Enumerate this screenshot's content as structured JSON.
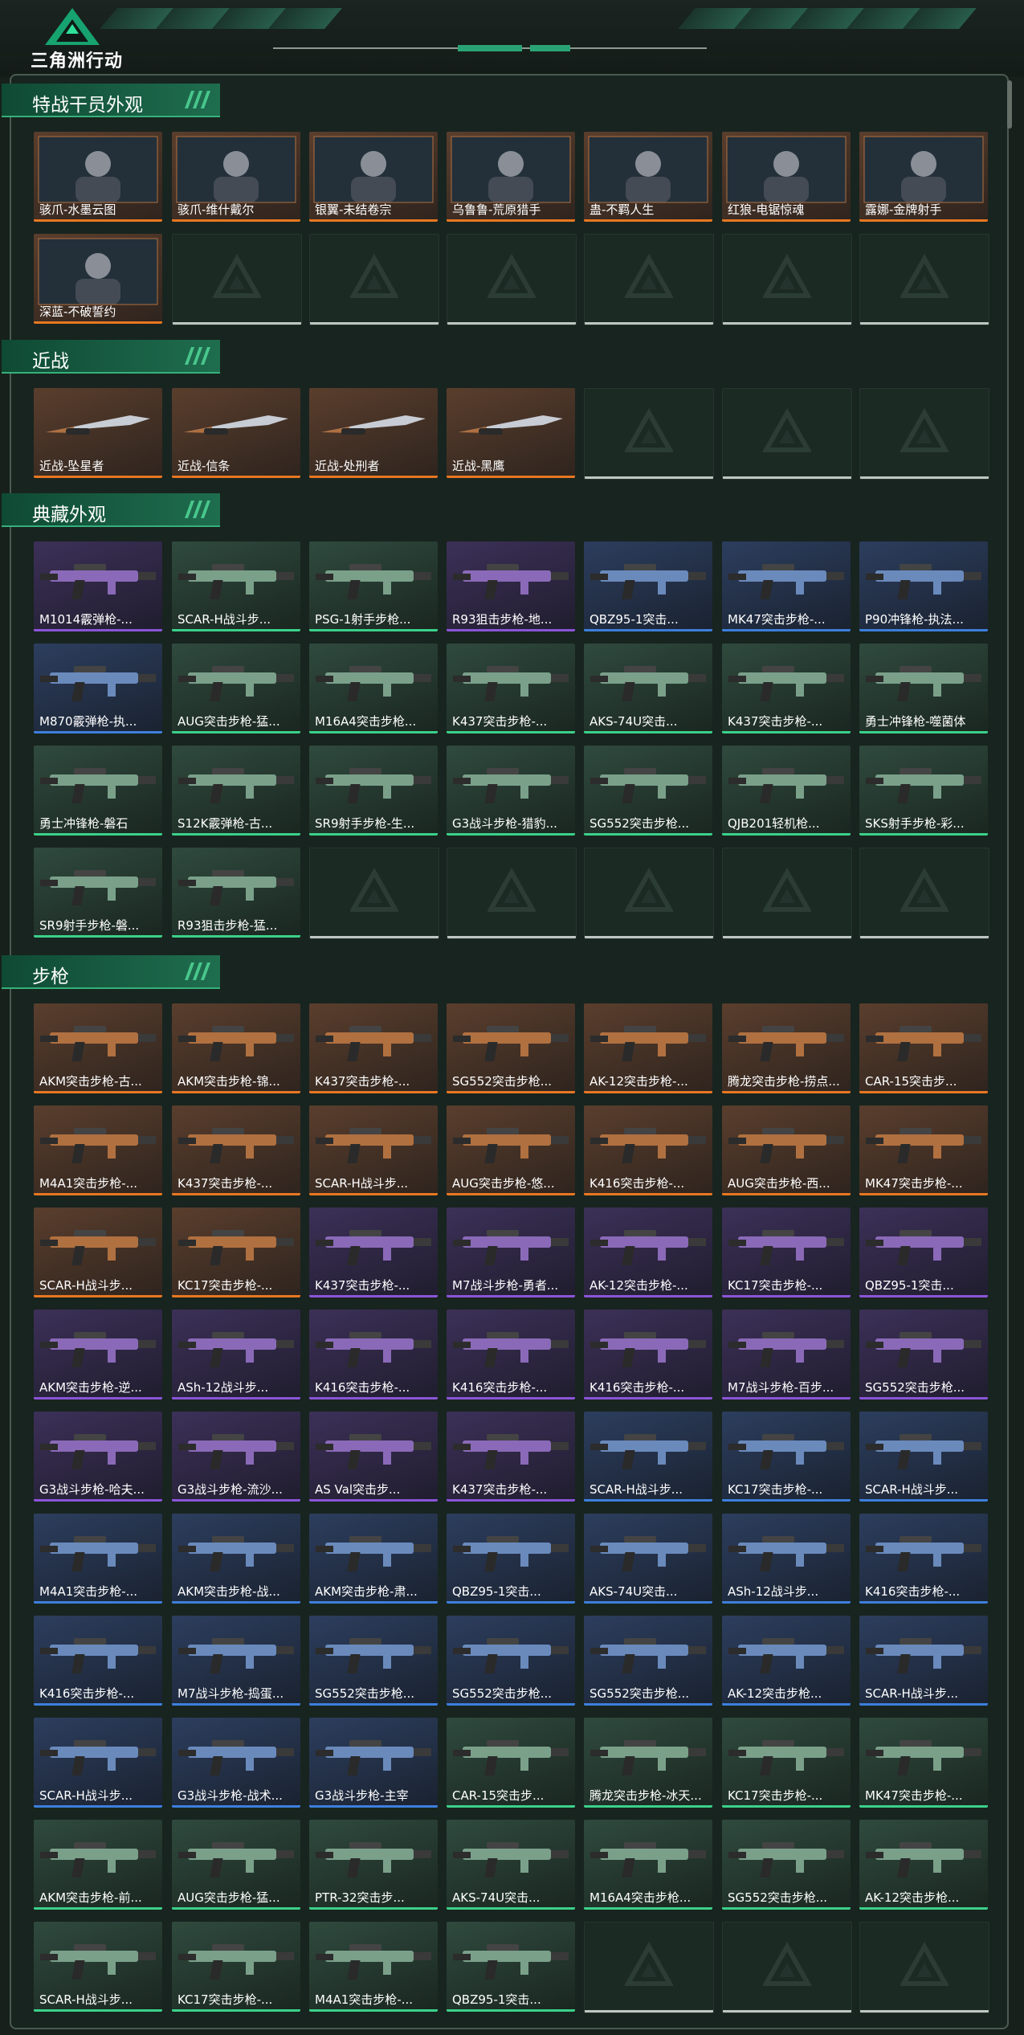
{
  "brand": {
    "title": "三角洲行动"
  },
  "colors": {
    "orange": "#e77722",
    "purple": "#8a55d8",
    "blue": "#3d7fdc",
    "green": "#3bd18a"
  },
  "sections": [
    {
      "title": "特战干员外观",
      "kind": "operator",
      "rows": [
        [
          {
            "label": "骇爪-水墨云图",
            "rarity": "orange"
          },
          {
            "label": "骇爪-维什戴尔",
            "rarity": "orange"
          },
          {
            "label": "银翼-未结卷宗",
            "rarity": "orange"
          },
          {
            "label": "乌鲁鲁-荒原猎手",
            "rarity": "orange"
          },
          {
            "label": "蛊-不羁人生",
            "rarity": "orange"
          },
          {
            "label": "红狼-电锯惊魂",
            "rarity": "orange"
          },
          {
            "label": "露娜-金牌射手",
            "rarity": "orange"
          }
        ],
        [
          {
            "label": "深蓝-不破誓约",
            "rarity": "orange"
          },
          null,
          null,
          null,
          null,
          null,
          null
        ]
      ]
    },
    {
      "title": "近战",
      "kind": "melee",
      "rows": [
        [
          {
            "label": "近战-坠星者",
            "rarity": "orange"
          },
          {
            "label": "近战-信条",
            "rarity": "orange"
          },
          {
            "label": "近战-处刑者",
            "rarity": "orange"
          },
          {
            "label": "近战-黑鹰",
            "rarity": "orange"
          },
          null,
          null,
          null
        ]
      ]
    },
    {
      "title": "典藏外观",
      "kind": "gun",
      "rows": [
        [
          {
            "label": "M1014霰弹枪-...",
            "rarity": "purple"
          },
          {
            "label": "SCAR-H战斗步...",
            "rarity": "green"
          },
          {
            "label": "PSG-1射手步枪...",
            "rarity": "green"
          },
          {
            "label": "R93狙击步枪-地...",
            "rarity": "purple"
          },
          {
            "label": "QBZ95-1突击...",
            "rarity": "blue"
          },
          {
            "label": "MK47突击步枪-...",
            "rarity": "blue"
          },
          {
            "label": "P90冲锋枪-执法...",
            "rarity": "blue"
          }
        ],
        [
          {
            "label": "M870霰弹枪-执...",
            "rarity": "blue"
          },
          {
            "label": "AUG突击步枪-猛...",
            "rarity": "green"
          },
          {
            "label": "M16A4突击步枪...",
            "rarity": "green"
          },
          {
            "label": "K437突击步枪-...",
            "rarity": "green"
          },
          {
            "label": "AKS-74U突击...",
            "rarity": "green"
          },
          {
            "label": "K437突击步枪-...",
            "rarity": "green"
          },
          {
            "label": "勇士冲锋枪-噬菌体",
            "rarity": "green"
          }
        ],
        [
          {
            "label": "勇士冲锋枪-磐石",
            "rarity": "green"
          },
          {
            "label": "S12K霰弹枪-古...",
            "rarity": "green"
          },
          {
            "label": "SR9射手步枪-生...",
            "rarity": "green"
          },
          {
            "label": "G3战斗步枪-猎豹...",
            "rarity": "green"
          },
          {
            "label": "SG552突击步枪...",
            "rarity": "green"
          },
          {
            "label": "QJB201轻机枪...",
            "rarity": "green"
          },
          {
            "label": "SKS射手步枪-彩...",
            "rarity": "green"
          }
        ],
        [
          {
            "label": "SR9射手步枪-磐...",
            "rarity": "green"
          },
          {
            "label": "R93狙击步枪-猛...",
            "rarity": "green"
          },
          null,
          null,
          null,
          null,
          null
        ]
      ]
    },
    {
      "title": "步枪",
      "kind": "gun",
      "rows": [
        [
          {
            "label": "AKM突击步枪-古...",
            "rarity": "orange"
          },
          {
            "label": "AKM突击步枪-锦...",
            "rarity": "orange"
          },
          {
            "label": "K437突击步枪-...",
            "rarity": "orange"
          },
          {
            "label": "SG552突击步枪...",
            "rarity": "orange"
          },
          {
            "label": "AK-12突击步枪-...",
            "rarity": "orange"
          },
          {
            "label": "腾龙突击步枪-捞点...",
            "rarity": "orange"
          },
          {
            "label": "CAR-15突击步...",
            "rarity": "orange"
          }
        ],
        [
          {
            "label": "M4A1突击步枪-...",
            "rarity": "orange"
          },
          {
            "label": "K437突击步枪-...",
            "rarity": "orange"
          },
          {
            "label": "SCAR-H战斗步...",
            "rarity": "orange"
          },
          {
            "label": "AUG突击步枪-悠...",
            "rarity": "orange"
          },
          {
            "label": "K416突击步枪-...",
            "rarity": "orange"
          },
          {
            "label": "AUG突击步枪-西...",
            "rarity": "orange"
          },
          {
            "label": "MK47突击步枪-...",
            "rarity": "orange"
          }
        ],
        [
          {
            "label": "SCAR-H战斗步...",
            "rarity": "orange"
          },
          {
            "label": "KC17突击步枪-...",
            "rarity": "orange"
          },
          {
            "label": "K437突击步枪-...",
            "rarity": "purple"
          },
          {
            "label": "M7战斗步枪-勇者...",
            "rarity": "purple"
          },
          {
            "label": "AK-12突击步枪-...",
            "rarity": "purple"
          },
          {
            "label": "KC17突击步枪-...",
            "rarity": "purple"
          },
          {
            "label": "QBZ95-1突击...",
            "rarity": "purple"
          }
        ],
        [
          {
            "label": "AKM突击步枪-逆...",
            "rarity": "purple"
          },
          {
            "label": "ASh-12战斗步...",
            "rarity": "purple"
          },
          {
            "label": "K416突击步枪-...",
            "rarity": "purple"
          },
          {
            "label": "K416突击步枪-...",
            "rarity": "purple"
          },
          {
            "label": "K416突击步枪-...",
            "rarity": "purple"
          },
          {
            "label": "M7战斗步枪-百步...",
            "rarity": "purple"
          },
          {
            "label": "SG552突击步枪...",
            "rarity": "purple"
          }
        ],
        [
          {
            "label": "G3战斗步枪-哈夫...",
            "rarity": "purple"
          },
          {
            "label": "G3战斗步枪-流沙...",
            "rarity": "purple"
          },
          {
            "label": "AS Val突击步...",
            "rarity": "purple"
          },
          {
            "label": "K437突击步枪-...",
            "rarity": "purple"
          },
          {
            "label": "SCAR-H战斗步...",
            "rarity": "blue"
          },
          {
            "label": "KC17突击步枪-...",
            "rarity": "blue"
          },
          {
            "label": "SCAR-H战斗步...",
            "rarity": "blue"
          }
        ],
        [
          {
            "label": "M4A1突击步枪-...",
            "rarity": "blue"
          },
          {
            "label": "AKM突击步枪-战...",
            "rarity": "blue"
          },
          {
            "label": "AKM突击步枪-肃...",
            "rarity": "blue"
          },
          {
            "label": "QBZ95-1突击...",
            "rarity": "blue"
          },
          {
            "label": "AKS-74U突击...",
            "rarity": "blue"
          },
          {
            "label": "ASh-12战斗步...",
            "rarity": "blue"
          },
          {
            "label": "K416突击步枪-...",
            "rarity": "blue"
          }
        ],
        [
          {
            "label": "K416突击步枪-...",
            "rarity": "blue"
          },
          {
            "label": "M7战斗步枪-捣蛋...",
            "rarity": "blue"
          },
          {
            "label": "SG552突击步枪...",
            "rarity": "blue"
          },
          {
            "label": "SG552突击步枪...",
            "rarity": "blue"
          },
          {
            "label": "SG552突击步枪...",
            "rarity": "blue"
          },
          {
            "label": "AK-12突击步枪...",
            "rarity": "blue"
          },
          {
            "label": "SCAR-H战斗步...",
            "rarity": "blue"
          }
        ],
        [
          {
            "label": "SCAR-H战斗步...",
            "rarity": "blue"
          },
          {
            "label": "G3战斗步枪-战术...",
            "rarity": "blue"
          },
          {
            "label": "G3战斗步枪-主宰",
            "rarity": "blue"
          },
          {
            "label": "CAR-15突击步...",
            "rarity": "green"
          },
          {
            "label": "腾龙突击步枪-冰天...",
            "rarity": "green"
          },
          {
            "label": "KC17突击步枪-...",
            "rarity": "green"
          },
          {
            "label": "MK47突击步枪-...",
            "rarity": "green"
          }
        ],
        [
          {
            "label": "AKM突击步枪-前...",
            "rarity": "green"
          },
          {
            "label": "AUG突击步枪-猛...",
            "rarity": "green"
          },
          {
            "label": "PTR-32突击步...",
            "rarity": "green"
          },
          {
            "label": "AKS-74U突击...",
            "rarity": "green"
          },
          {
            "label": "M16A4突击步枪...",
            "rarity": "green"
          },
          {
            "label": "SG552突击步枪...",
            "rarity": "green"
          },
          {
            "label": "AK-12突击步枪...",
            "rarity": "green"
          }
        ],
        [
          {
            "label": "SCAR-H战斗步...",
            "rarity": "green"
          },
          {
            "label": "KC17突击步枪-...",
            "rarity": "green"
          },
          {
            "label": "M4A1突击步枪-...",
            "rarity": "green"
          },
          {
            "label": "QBZ95-1突击...",
            "rarity": "green"
          },
          null,
          null,
          null
        ]
      ]
    }
  ]
}
